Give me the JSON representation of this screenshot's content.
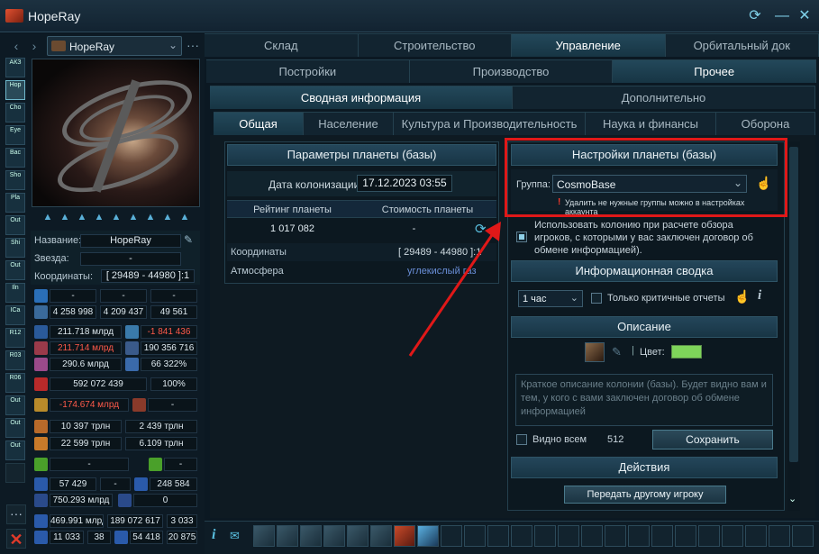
{
  "app": {
    "title": "HopeRay"
  },
  "nav": {
    "planet_name": "HopeRay"
  },
  "sidebar": {
    "items": [
      "АКЗ",
      "Hop",
      "Cho",
      "Eye",
      "Bac",
      "Sho",
      "Pla",
      "Out",
      "Shi",
      "Out",
      "Iln",
      "ICa",
      "R12",
      "R03",
      "R06",
      "Out",
      "Out",
      "Out"
    ]
  },
  "planet_info": {
    "name_label": "Название:",
    "name_value": "HopeRay",
    "star_label": "Звезда:",
    "star_value": "-",
    "coords_label": "Координаты:",
    "coords_value": "[ 29489 - 44980 ]:1"
  },
  "stats": {
    "r1": [
      "-",
      "-",
      "-"
    ],
    "r2": [
      "4 258 998",
      "4 209 437",
      "49 561"
    ],
    "r3a": "211.718 млрд",
    "r3b": "-1 841 436",
    "r4a": "211.714 млрд",
    "r4b": "190 356 716",
    "r5a": "290.6 млрд",
    "r5b": "66 322%",
    "r6a": "592 072 439",
    "r6b": "100%",
    "r7a": "-174.674 млрд",
    "r7b": "-",
    "r8a": "10 397 трлн",
    "r8b": "2 439 трлн",
    "r9a": "22 599 трлн",
    "r9b": "6.109 трлн",
    "r10a": "-",
    "r10b": "-",
    "r11": [
      "57 429",
      "-",
      "248 584"
    ],
    "r12a": "750.293 млрд",
    "r12b": "0",
    "r13": [
      "469.991 млрд",
      "189 072 617",
      "3 033"
    ],
    "r14": [
      "11 033",
      "38",
      "54 418",
      "20 875"
    ]
  },
  "tabs_top": [
    "Склад",
    "Строительство",
    "Управление",
    "Орбитальный док"
  ],
  "tabs_second": [
    "Постройки",
    "Производство",
    "Прочее"
  ],
  "tabs_third": [
    "Сводная информация",
    "Дополнительно"
  ],
  "tabs_fourth": [
    "Общая",
    "Население",
    "Культура и Производительность",
    "Наука и финансы",
    "Оборона"
  ],
  "params": {
    "header": "Параметры планеты (базы)",
    "colonization_label": "Дата колонизации:",
    "colonization_value": "17.12.2023 03:55",
    "rating_label": "Рейтинг планеты",
    "cost_label": "Стоимость планеты",
    "rating_value": "1 017 082",
    "cost_value": "-",
    "coords_label": "Координаты",
    "coords_value": "[ 29489 - 44980 ]:1",
    "atmosphere_label": "Атмосфера",
    "atmosphere_value": "углекислый газ"
  },
  "settings": {
    "header": "Настройки планеты (базы)",
    "group_label": "Группа:",
    "group_value": "CosmoBase",
    "group_note": "Удалить не нужные группы можно в настройках аккаунта",
    "use_colony_text": "Использовать колонию при расчете обзора игроков, с которыми у вас заключен договор об обмене информацией)."
  },
  "summary": {
    "header": "Информационная сводка",
    "period_value": "1 час",
    "critical_only_label": "Только критичные отчеты"
  },
  "description": {
    "header": "Описание",
    "color_label": "Цвет:",
    "color_value": "#7ed45a",
    "placeholder": "Краткое описание колонии (базы). Будет видно вам и тем, у кого с вами заключен договор об обмене информацией",
    "visible_all_label": "Видно всем",
    "char_count": "512",
    "save_label": "Сохранить"
  },
  "actions": {
    "header": "Действия",
    "transfer_label": "Передать другому игроку"
  },
  "colors": {
    "accent": "#e01818",
    "highlight_border": "#e01818"
  }
}
